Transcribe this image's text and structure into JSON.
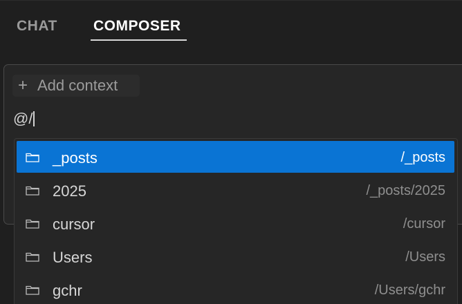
{
  "tabs": [
    {
      "label": "CHAT",
      "active": false
    },
    {
      "label": "COMPOSER",
      "active": true
    }
  ],
  "composer": {
    "add_context_label": "Add context",
    "input_value": "@/"
  },
  "suggestions": [
    {
      "name": "_posts",
      "path": "/_posts",
      "icon": "folder-icon",
      "selected": true
    },
    {
      "name": "2025",
      "path": "/_posts/2025",
      "icon": "folder-icon",
      "selected": false
    },
    {
      "name": "cursor",
      "path": "/cursor",
      "icon": "folder-icon",
      "selected": false
    },
    {
      "name": "Users",
      "path": "/Users",
      "icon": "folder-icon",
      "selected": false
    },
    {
      "name": "gchr",
      "path": "/Users/gchr",
      "icon": "folder-icon",
      "selected": false
    }
  ],
  "colors": {
    "background": "#1f1f1f",
    "selection": "#0a74d4",
    "muted_text": "#8f8f8f"
  }
}
